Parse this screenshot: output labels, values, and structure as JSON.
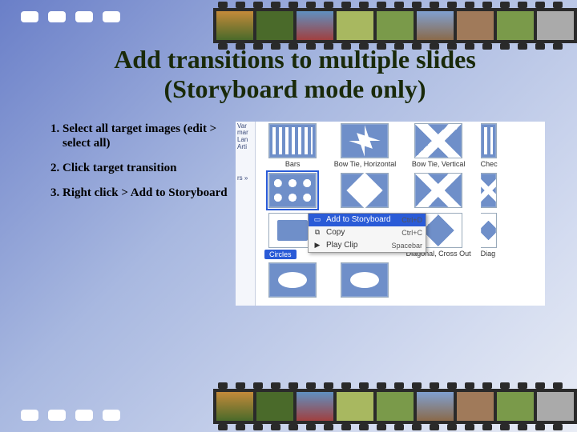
{
  "title_line1": "Add transitions to multiple slides",
  "title_line2": "(Storyboard mode only)",
  "steps": [
    "Select all target images (edit > select all)",
    "Click target transition",
    "Right click > Add to Storyboard"
  ],
  "sidebar": {
    "lines": [
      "Var",
      "mar",
      "Lan",
      "Arti",
      "rs »"
    ]
  },
  "transitions": {
    "r1": [
      {
        "label": "Bars"
      },
      {
        "label": "Bow Tie, Horizontal"
      },
      {
        "label": "Bow Tie, Vertical"
      },
      {
        "label": "Chec"
      }
    ],
    "r2_selected_label": "Circles",
    "r3": [
      {
        "label": ""
      },
      {
        "label": ""
      },
      {
        "label": "Diagonal, Cross Out"
      },
      {
        "label": "Diag"
      }
    ]
  },
  "context_menu": {
    "items": [
      {
        "label": "Add to Storyboard",
        "shortcut": "Ctrl+D",
        "highlight": true
      },
      {
        "label": "Copy",
        "shortcut": "Ctrl+C",
        "highlight": false
      },
      {
        "label": "Play Clip",
        "shortcut": "Spacebar",
        "highlight": false
      }
    ]
  }
}
